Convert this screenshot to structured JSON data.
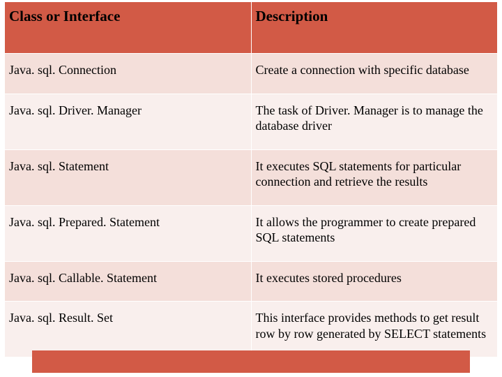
{
  "chart_data": {
    "type": "table",
    "columns": [
      "Class or Interface",
      "Description"
    ],
    "rows": [
      [
        "Java. sql. Connection",
        "Create a connection with specific database"
      ],
      [
        "Java. sql. Driver. Manager",
        "The task of Driver. Manager is to manage the database driver"
      ],
      [
        "Java. sql. Statement",
        "It executes SQL statements for particular connection and retrieve the results"
      ],
      [
        "Java. sql. Prepared. Statement",
        "It allows the programmer to create prepared SQL statements"
      ],
      [
        "Java. sql. Callable. Statement",
        "It executes stored procedures"
      ],
      [
        "Java. sql. Result. Set",
        "This interface provides methods to get result row by row generated by SELECT statements"
      ]
    ]
  },
  "header": {
    "col1": "Class or Interface",
    "col2": "Description"
  },
  "rows": {
    "r0": {
      "c1": "Java. sql. Connection",
      "c2": "Create a connection with specific database"
    },
    "r1": {
      "c1": "Java. sql. Driver. Manager",
      "c2": "The task of Driver. Manager is to manage the database driver"
    },
    "r2": {
      "c1": "Java. sql. Statement",
      "c2": "It executes SQL statements for particular connection and retrieve the results"
    },
    "r3": {
      "c1": "Java. sql. Prepared. Statement",
      "c2": "It allows the programmer to create prepared SQL statements"
    },
    "r4": {
      "c1": "Java. sql. Callable. Statement",
      "c2": "It executes stored procedures"
    },
    "r5": {
      "c1": "Java. sql. Result. Set",
      "c2": "This interface provides methods to get result row by row generated by SELECT statements"
    }
  }
}
